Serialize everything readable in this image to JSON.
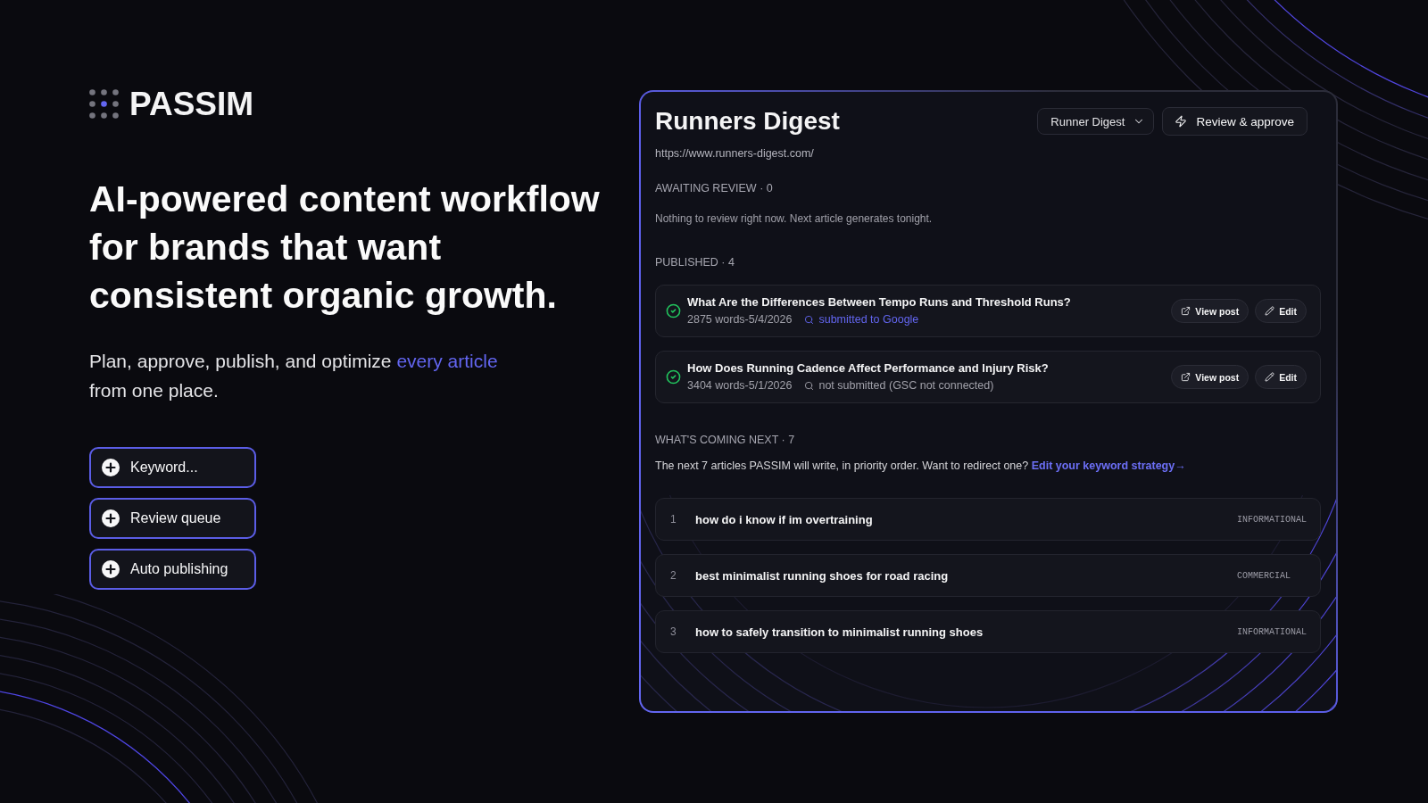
{
  "brand": {
    "name": "PASSIM"
  },
  "hero": {
    "headline": "AI-powered content workflow for brands that want consistent organic growth.",
    "tagline": {
      "before": "Plan, approve, publish, and optimize",
      "highlight": "every article",
      "after": "from one place."
    }
  },
  "features": [
    {
      "label": "Keyword..."
    },
    {
      "label": "Review queue"
    },
    {
      "label": "Auto publishing"
    }
  ],
  "panel": {
    "title": "Runners Digest",
    "site_selector": {
      "value": "Runner Digest"
    },
    "primary_action": {
      "label": "Review & approve"
    },
    "url": "https://www.runners-digest.com/",
    "awaiting_review": {
      "heading": "AWAITING REVIEW · 0",
      "message": "Nothing to review right now. Next article generates tonight."
    },
    "published": {
      "heading": "PUBLISHED · 4",
      "articles": [
        {
          "title": "What Are the Differences Between Tempo Runs and Threshold Runs?",
          "meta": "2875 words-5/4/2026",
          "index_status": {
            "text": "submitted to Google",
            "submitted": true
          },
          "actions": [
            {
              "kind": "view",
              "label": "View post"
            },
            {
              "kind": "edit",
              "label": "Edit"
            }
          ]
        },
        {
          "title": "How Does Running Cadence Affect Performance and Injury Risk?",
          "meta": "3404 words-5/1/2026",
          "index_status": {
            "text": "not submitted (GSC not connected)",
            "submitted": false
          },
          "actions": [
            {
              "kind": "view",
              "label": "View post"
            },
            {
              "kind": "edit",
              "label": "Edit"
            }
          ]
        }
      ]
    },
    "coming_next": {
      "heading": "WHAT'S COMING NEXT · 7",
      "intro": "The next 7 articles PASSIM will write, in priority order. Want to redirect one?",
      "link": "Edit your keyword strategy→",
      "keywords": [
        {
          "rank": "1",
          "keyword": "how do i know if im overtraining",
          "intent": "INFORMATIONAL"
        },
        {
          "rank": "2",
          "keyword": "best minimalist running shoes for road racing",
          "intent": "COMMERCIAL"
        },
        {
          "rank": "3",
          "keyword": "how to safely transition to minimalist running shoes",
          "intent": "INFORMATIONAL"
        }
      ]
    }
  }
}
